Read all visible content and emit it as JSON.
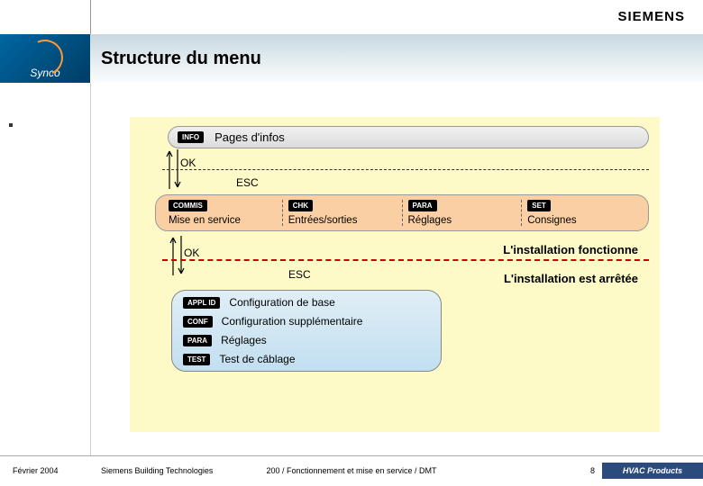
{
  "brand": {
    "siemens": "SIEMENS",
    "synco": "Synco"
  },
  "title": "Structure du menu",
  "level1": {
    "lcd": "INFO",
    "label": "Pages d'infos"
  },
  "nav": {
    "ok": "OK",
    "esc": "ESC"
  },
  "level2": {
    "items": [
      {
        "lcd": "COMMIS",
        "label": "Mise en service"
      },
      {
        "lcd": "CHK",
        "label": "Entrées/sorties"
      },
      {
        "lcd": "PARA",
        "label": "Réglages"
      },
      {
        "lcd": "SET",
        "label": "Consignes"
      }
    ]
  },
  "status": {
    "running": "L'installation fonctionne",
    "stopped": "L'installation est arrêtée"
  },
  "level3": {
    "items": [
      {
        "lcd": "APPL ID",
        "label": "Configuration de base"
      },
      {
        "lcd": "CONF",
        "label": "Configuration supplémentaire"
      },
      {
        "lcd": "PARA",
        "label": "Réglages"
      },
      {
        "lcd": "TEST",
        "label": "Test de câblage"
      }
    ]
  },
  "footer": {
    "date": "Février 2004",
    "company": "Siemens Building Technologies",
    "doc": "200 / Fonctionnement et mise en service / DMT",
    "page": "8",
    "brand": "HVAC Products"
  }
}
